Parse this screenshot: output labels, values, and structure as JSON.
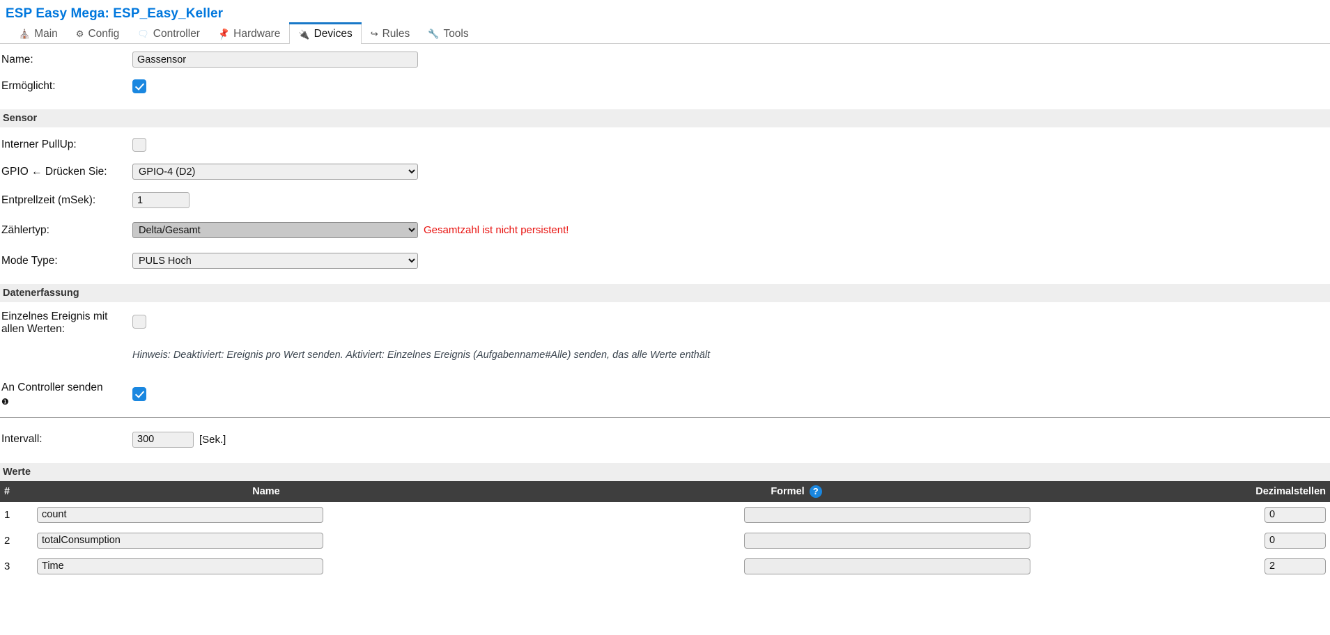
{
  "header": {
    "title": "ESP Easy Mega: ESP_Easy_Keller"
  },
  "tabs": [
    {
      "label": "Main",
      "icon": "home-icon",
      "glyph": "⌂",
      "active": false
    },
    {
      "label": "Config",
      "icon": "gear-icon",
      "glyph": "⚙",
      "active": false
    },
    {
      "label": "Controller",
      "icon": "chat-icon",
      "glyph": "὞8",
      "active": false
    },
    {
      "label": "Hardware",
      "icon": "pin-icon",
      "glyph": "ὌC",
      "active": false
    },
    {
      "label": "Devices",
      "icon": "plug-icon",
      "glyph": "ὐC",
      "active": true
    },
    {
      "label": "Rules",
      "icon": "arrow-icon",
      "glyph": "↪",
      "active": false
    },
    {
      "label": "Tools",
      "icon": "wrench-icon",
      "glyph": "ὒ7",
      "active": false
    }
  ],
  "form": {
    "name_label": "Name:",
    "name_value": "Gassensor",
    "enabled_label": "Ermöglicht:",
    "enabled_checked": true
  },
  "sensor": {
    "heading": "Sensor",
    "pullup_label": "Interner PullUp:",
    "pullup_checked": false,
    "gpio_label": "GPIO ← Drücken Sie:",
    "gpio_value": "GPIO-4 (D2)",
    "debounce_label": "Entprellzeit (mSek):",
    "debounce_value": "1",
    "countertype_label": "Zählertyp:",
    "countertype_value": "Delta/Gesamt",
    "countertype_warning": "Gesamtzahl ist nicht persistent!",
    "modetype_label": "Mode Type:",
    "modetype_value": "PULS Hoch"
  },
  "datacapture": {
    "heading": "Datenerfassung",
    "single_event_label": "Einzelnes Ereignis mit allen Werten:",
    "single_event_checked": false,
    "hint": "Hinweis: Deaktiviert: Ereignis pro Wert senden. Aktiviert: Einzelnes Ereignis (Aufgabenname#Alle) senden, das alle Werte enthält",
    "send_to_controller_label": "An Controller senden",
    "send_to_controller_checked": true,
    "interval_label": "Intervall:",
    "interval_value": "300",
    "interval_unit": "[Sek.]"
  },
  "values": {
    "heading": "Werte",
    "columns": {
      "index": "#",
      "name": "Name",
      "formula": "Formel",
      "decimals": "Dezimalstellen"
    },
    "help_glyph": "?",
    "rows": [
      {
        "index": "1",
        "name": "count",
        "formula": "",
        "decimals": "0"
      },
      {
        "index": "2",
        "name": "totalConsumption",
        "formula": "",
        "decimals": "0"
      },
      {
        "index": "3",
        "name": "Time",
        "formula": "",
        "decimals": "2"
      }
    ]
  },
  "colors": {
    "accent": "#1a87e0",
    "title": "#0077dd",
    "warning": "#e8120f",
    "table_header_bg": "#3e3e3e",
    "section_bg": "#eeeeee"
  }
}
